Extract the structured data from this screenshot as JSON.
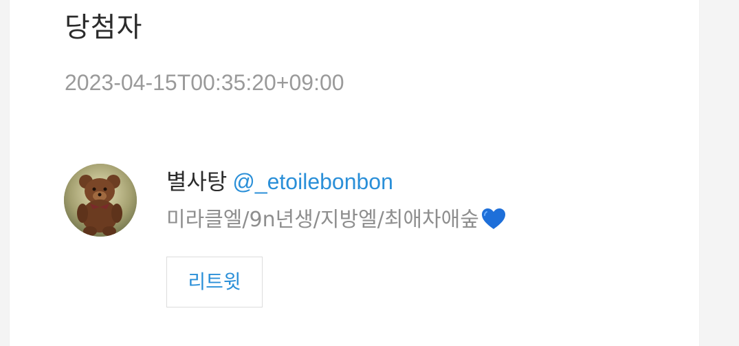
{
  "post": {
    "title": "당첨자",
    "timestamp": "2023-04-15T00:35:20+09:00"
  },
  "user": {
    "display_name": "별사탕",
    "handle": "@_etoilebonbon",
    "bio": "미라클엘/9n년생/지방엘/최애차애숲",
    "bio_emoji": "blue-heart-icon",
    "avatar": "teddy-bear-photo"
  },
  "actions": {
    "retweet_label": "리트윗"
  },
  "colors": {
    "link": "#2a8fd8",
    "muted": "#9a9a9a",
    "text": "#2b2b2b",
    "heart": "#1e6fd9"
  }
}
